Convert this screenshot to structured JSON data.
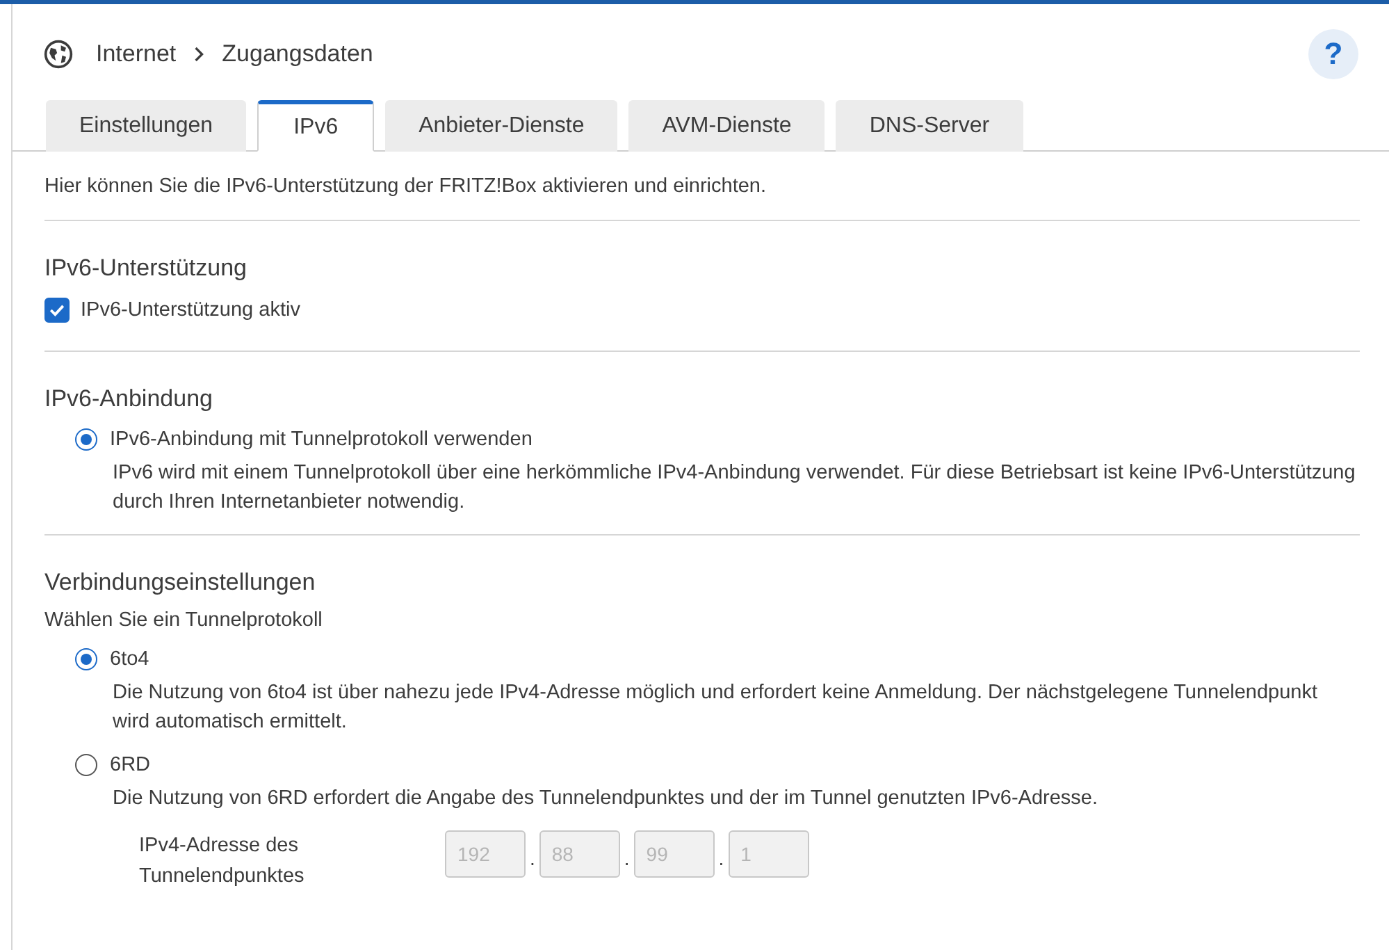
{
  "breadcrumb": [
    "Internet",
    "Zugangsdaten"
  ],
  "help": "?",
  "tabs": [
    {
      "label": "Einstellungen",
      "selected": false
    },
    {
      "label": "IPv6",
      "selected": true
    },
    {
      "label": "Anbieter-Dienste",
      "selected": false
    },
    {
      "label": "AVM-Dienste",
      "selected": false
    },
    {
      "label": "DNS-Server",
      "selected": false
    }
  ],
  "intro": "Hier können Sie die IPv6-Unterstützung der FRITZ!Box aktivieren und einrichten.",
  "support": {
    "heading": "IPv6-Unterstützung",
    "checkbox": {
      "label": "IPv6-Unterstützung aktiv",
      "checked": true
    }
  },
  "connection": {
    "heading": "IPv6-Anbindung",
    "options": [
      {
        "label": "IPv6-Anbindung mit Tunnelprotokoll verwenden",
        "selected": true,
        "description": "IPv6 wird mit einem Tunnelprotokoll über eine herkömmliche IPv4-Anbindung verwendet. Für diese Betriebsart ist keine IPv6-Unterstützung durch Ihren Internetanbieter notwendig."
      }
    ]
  },
  "settings": {
    "heading": "Verbindungseinstellungen",
    "prompt": "Wählen Sie ein Tunnelprotokoll",
    "options": [
      {
        "label": "6to4",
        "selected": true,
        "description": "Die Nutzung von 6to4 ist über nahezu jede IPv4-Adresse möglich und erfordert keine Anmeldung. Der nächstgelegene Tunnelendpunkt wird automatisch ermittelt."
      },
      {
        "label": "6RD",
        "selected": false,
        "description": "Die Nutzung von 6RD erfordert die Angabe des Tunnelendpunktes und der im Tunnel genutzten IPv6-Adresse."
      }
    ],
    "address": {
      "label": "IPv4-Adresse des Tunnelendpunktes",
      "disabled": true,
      "octets": [
        "192",
        "88",
        "99",
        "1"
      ],
      "separators": [
        ".",
        ".",
        "."
      ]
    }
  }
}
